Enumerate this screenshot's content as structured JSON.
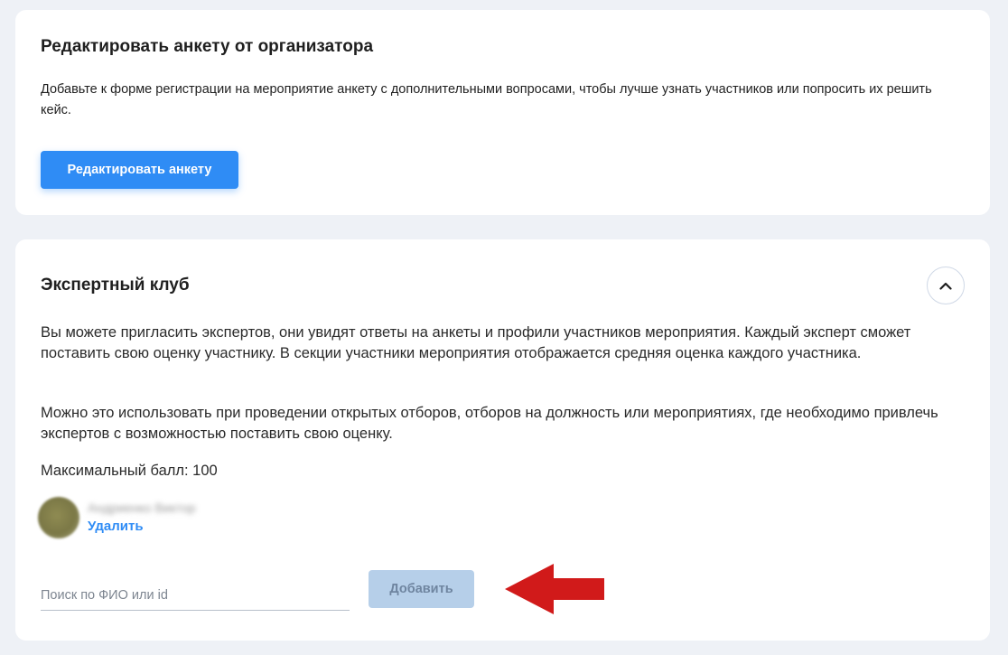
{
  "organizer_form": {
    "title": "Редактировать анкету от организатора",
    "description": "Добавьте к форме регистрации на мероприятие анкету с дополнительными вопросами, чтобы лучше узнать участников или попросить их решить кейс.",
    "edit_button": "Редактировать анкету"
  },
  "expert_club": {
    "title": "Экспертный клуб",
    "collapse_icon": "chevron-up-icon",
    "paragraph_1": "Вы можете пригласить экспертов, они увидят ответы на анкеты и профили участников мероприятия. Каждый эксперт сможет поставить свою оценку участнику. В секции участники мероприятия отображается средняя оценка каждого участника.",
    "paragraph_2": "Можно это использовать при проведении открытых отборов, отборов на должность или мероприятиях, где необходимо привлечь экспертов с возможностью поставить свою оценку.",
    "max_score": "Максимальный балл: 100",
    "expert": {
      "name": "Андриенко Виктор",
      "remove_label": "Удалить"
    },
    "search": {
      "placeholder": "Поиск по ФИО или id",
      "value": ""
    },
    "add_button": "Добавить"
  },
  "colors": {
    "accent": "#2f8cf5",
    "disabled_button": "#b6cfe9",
    "annotation_arrow": "#d11a1a",
    "background": "#eef1f6"
  }
}
